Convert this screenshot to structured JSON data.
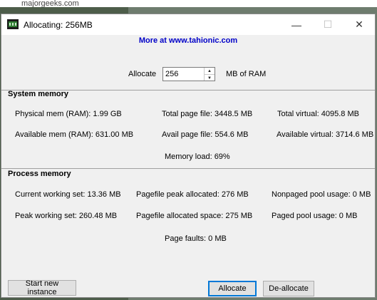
{
  "background": {
    "url_fragment": "majorgeeks.com"
  },
  "window": {
    "title": "Allocating: 256MB",
    "icon": "app-icon",
    "controls": {
      "minimize": "—",
      "maximize": "☐",
      "close": "✕"
    }
  },
  "link_text": "More at www.tahionic.com",
  "allocate": {
    "label": "Allocate",
    "value": "256",
    "unit": "MB of RAM"
  },
  "system_memory": {
    "title": "System memory",
    "physical": "Physical mem (RAM): 1.99 GB",
    "available": "Available mem (RAM): 631.00 MB",
    "total_page_file": "Total page file: 3448.5 MB",
    "avail_page_file": "Avail page file: 554.6 MB",
    "total_virtual": "Total virtual: 4095.8 MB",
    "available_virtual": "Available virtual: 3714.6 MB",
    "memory_load": "Memory load: 69%"
  },
  "process_memory": {
    "title": "Process memory",
    "current_working_set": "Current working set: 13.36 MB",
    "peak_working_set": "Peak working set: 260.48 MB",
    "pagefile_peak": "Pagefile peak allocated: 276 MB",
    "pagefile_space": "Pagefile allocated space: 275 MB",
    "nonpaged_pool": "Nonpaged pool usage: 0 MB",
    "paged_pool": "Paged pool usage: 0 MB",
    "page_faults": "Page faults: 0 MB"
  },
  "buttons": {
    "start_new_instance": "Start new instance",
    "allocate": "Allocate",
    "deallocate": "De-allocate"
  },
  "colors": {
    "link": "#0000c8",
    "dialog_bg": "#f0f0f0",
    "focus_border": "#0078d7"
  }
}
